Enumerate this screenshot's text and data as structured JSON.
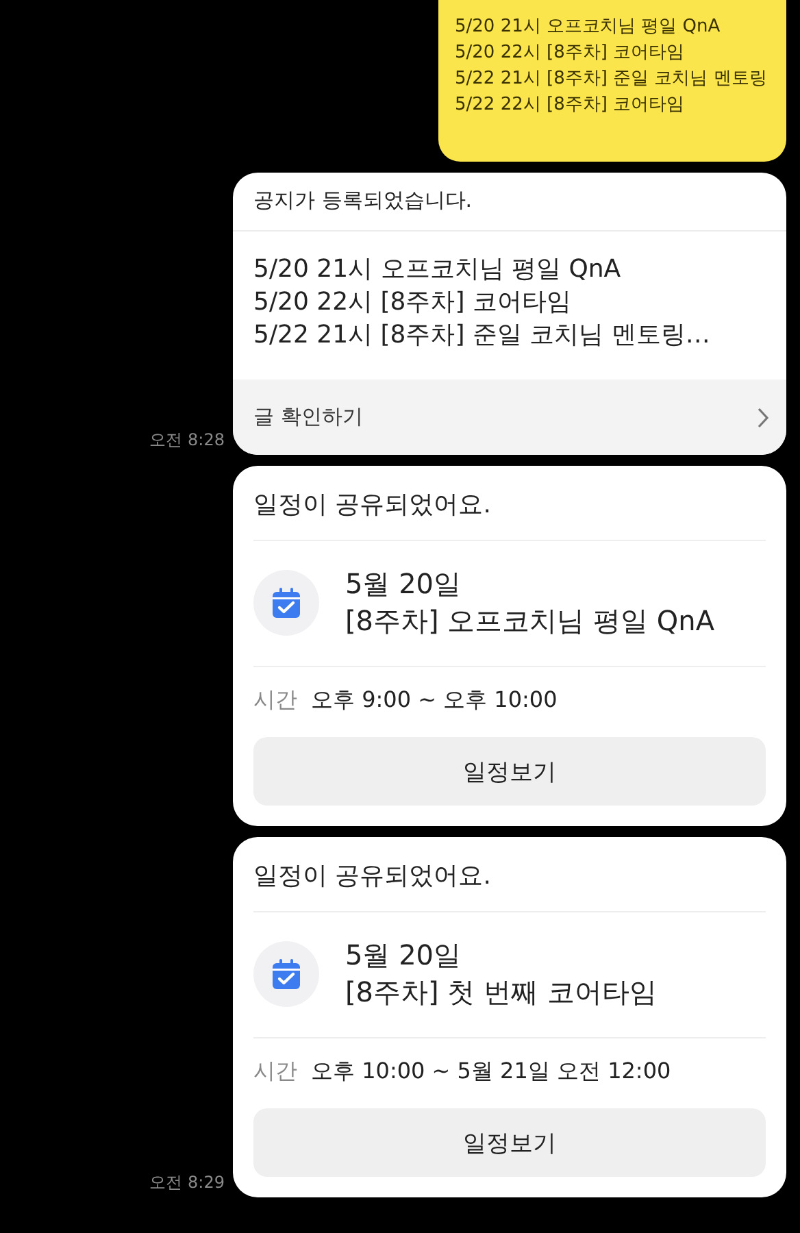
{
  "messages": [
    {
      "kind": "mine",
      "lines": [
        "5/20 21시 오프코치님 평일 QnA",
        "5/20 22시 [8주차] 코어타임",
        "5/22 21시 [8주차] 준일 코치님 멘토링",
        "5/22 22시 [8주차] 코어타임"
      ]
    },
    {
      "kind": "notice",
      "header": "공지가 등록되었습니다.",
      "lines": [
        "5/20 21시 오프코치님 평일 QnA",
        "5/20 22시 [8주차] 코어타임",
        "5/22 21시 [8주차] 준일 코치님 멘토링…"
      ],
      "link": "글 확인하기",
      "time": "오전 8:28"
    },
    {
      "kind": "schedule",
      "header": "일정이 공유되었어요.",
      "date": "5월 20일",
      "title": "[8주차] 오프코치님 평일 QnA",
      "time_label": "시간",
      "time_range": "오후 9:00 ~ 오후 10:00",
      "button": "일정보기"
    },
    {
      "kind": "schedule",
      "header": "일정이 공유되었어요.",
      "date": "5월 20일",
      "title": "[8주차] 첫 번째 코어타임",
      "time_label": "시간",
      "time_range": "오후 10:00 ~ 5월 21일 오전 12:00",
      "button": "일정보기",
      "time": "오전 8:29"
    }
  ]
}
